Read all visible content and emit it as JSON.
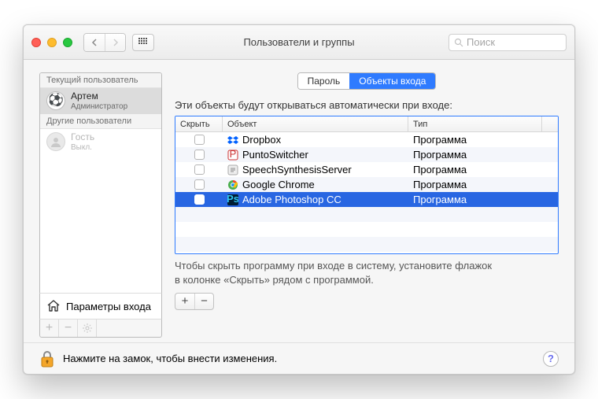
{
  "window": {
    "title": "Пользователи и группы"
  },
  "search": {
    "placeholder": "Поиск"
  },
  "sidebar": {
    "section_current": "Текущий пользователь",
    "section_other": "Другие пользователи",
    "current": {
      "name": "Артем",
      "role": "Администратор"
    },
    "guest": {
      "name": "Гость",
      "role": "Выкл."
    },
    "login_options": "Параметры входа"
  },
  "tabs": {
    "password": "Пароль",
    "login_items": "Объекты входа"
  },
  "main": {
    "intro": "Эти объекты будут открываться автоматически при входе:",
    "columns": {
      "hide": "Скрыть",
      "object": "Объект",
      "type": "Тип"
    },
    "rows": [
      {
        "name": "Dropbox",
        "type": "Программа",
        "icon": "dropbox",
        "selected": false
      },
      {
        "name": "PuntoSwitcher",
        "type": "Программа",
        "icon": "punto",
        "selected": false
      },
      {
        "name": "SpeechSynthesisServer",
        "type": "Программа",
        "icon": "speech",
        "selected": false
      },
      {
        "name": "Google Chrome",
        "type": "Программа",
        "icon": "chrome",
        "selected": false
      },
      {
        "name": "Adobe Photoshop CC",
        "type": "Программа",
        "icon": "ps",
        "selected": true
      }
    ],
    "hint1": "Чтобы скрыть программу при входе в систему, установите флажок",
    "hint2": "в колонке «Скрыть» рядом с программой."
  },
  "lockbar": {
    "text": "Нажмите на замок, чтобы внести изменения."
  }
}
